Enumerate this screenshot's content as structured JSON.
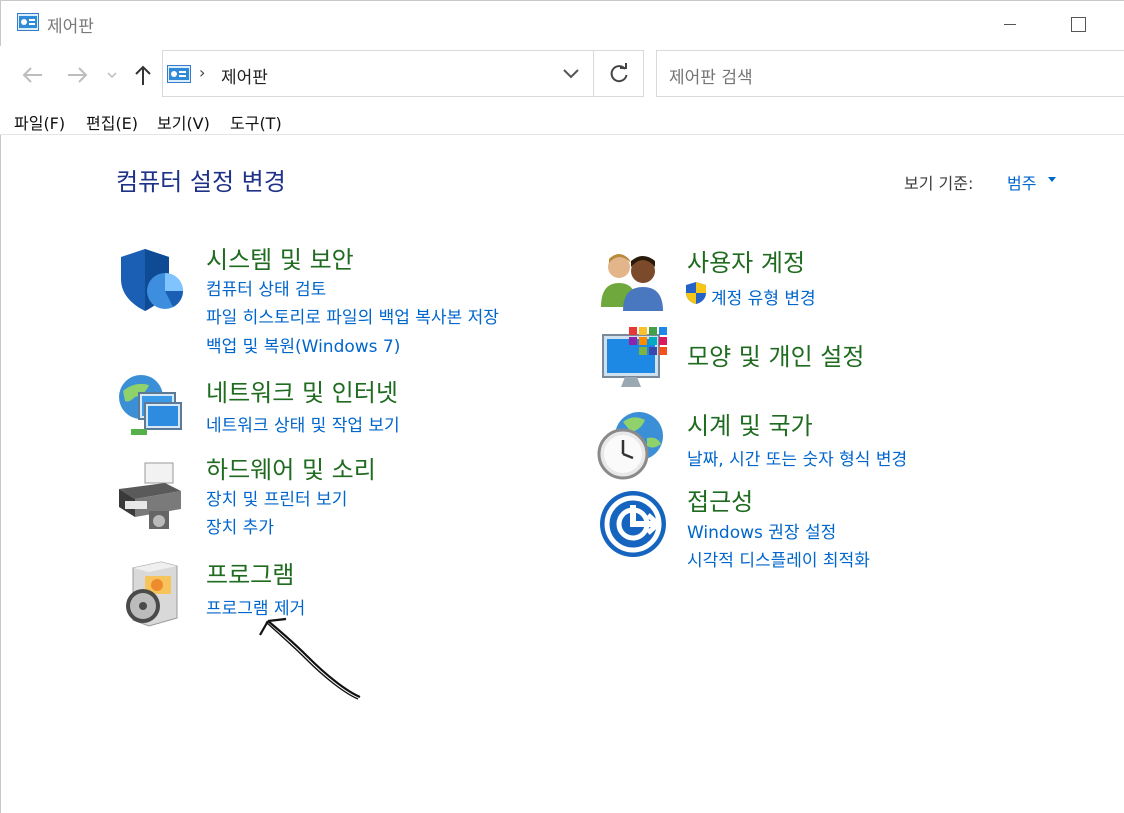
{
  "window": {
    "title": "제어판"
  },
  "address_bar": {
    "path": "제어판",
    "search_placeholder": "제어판 검색"
  },
  "menu": {
    "items": [
      "파일(F)",
      "편집(E)",
      "보기(V)",
      "도구(T)"
    ]
  },
  "main": {
    "heading": "컴퓨터 설정 변경",
    "view_by_label": "보기 기준:",
    "view_by_value": "범주"
  },
  "categories": {
    "system_security": {
      "title": "시스템 및 보안",
      "links": [
        "컴퓨터 상태 검토",
        "파일 히스토리로 파일의 백업 복사본 저장",
        "백업 및 복원(Windows 7)"
      ],
      "icon": "shield-icon"
    },
    "network": {
      "title": "네트워크 및 인터넷",
      "links": [
        "네트워크 상태 및 작업 보기"
      ],
      "icon": "network-globe-icon"
    },
    "hardware_sound": {
      "title": "하드웨어 및 소리",
      "links": [
        "장치 및 프린터 보기",
        "장치 추가"
      ],
      "icon": "printer-icon"
    },
    "programs": {
      "title": "프로그램",
      "links": [
        "프로그램 제거"
      ],
      "icon": "programs-disc-icon"
    },
    "user_accounts": {
      "title": "사용자 계정",
      "links": [
        "계정 유형 변경"
      ],
      "icon": "users-icon"
    },
    "appearance": {
      "title": "모양 및 개인 설정",
      "links": [],
      "icon": "appearance-monitor-icon"
    },
    "clock_region": {
      "title": "시계 및 국가",
      "links": [
        "날짜, 시간 또는 숫자 형식 변경"
      ],
      "icon": "clock-globe-icon"
    },
    "ease_of_access": {
      "title": "접근성",
      "links": [
        "Windows 권장 설정",
        "시각적 디스플레이 최적화"
      ],
      "icon": "ease-of-access-icon"
    }
  },
  "colors": {
    "heading": "#1e3287",
    "category_title": "#1f6b1f",
    "link": "#0066cc"
  }
}
